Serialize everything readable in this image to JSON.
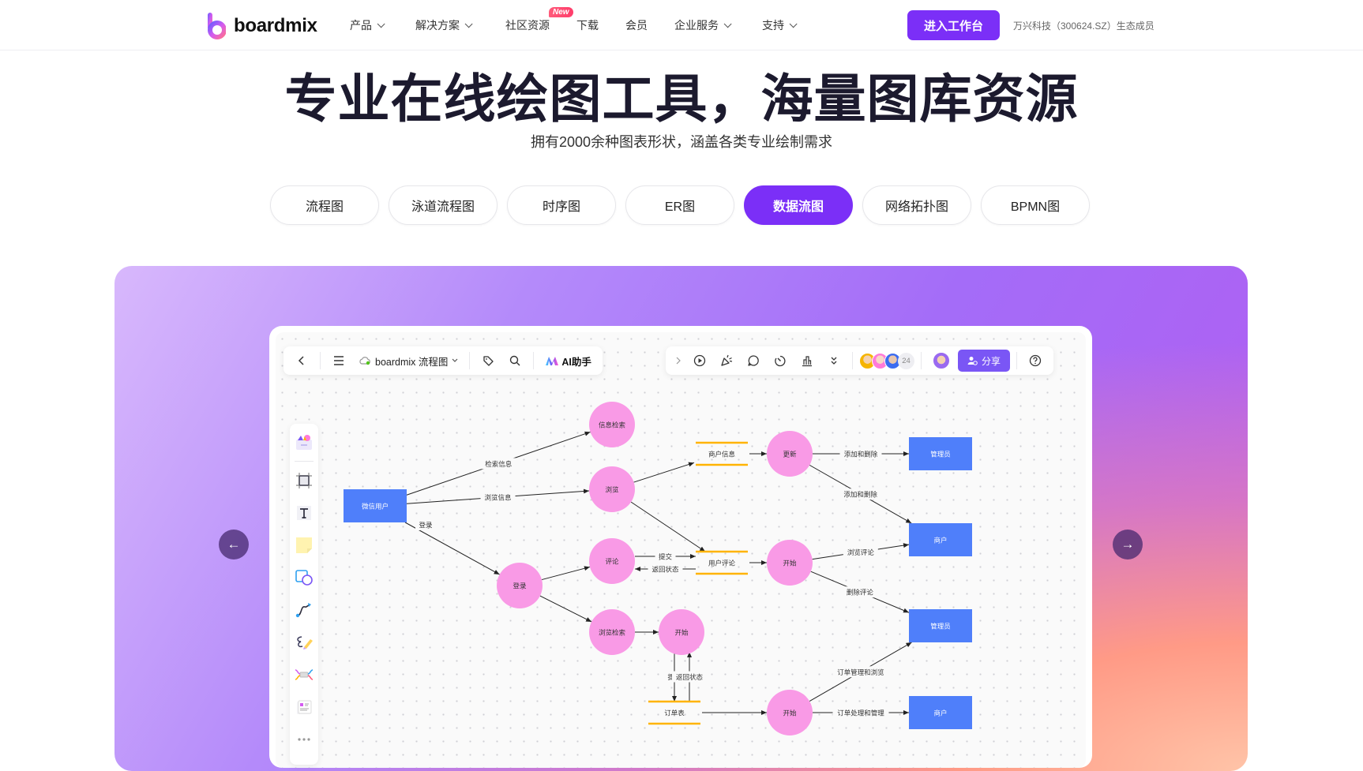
{
  "nav": {
    "logo_text": "boardmix",
    "items": [
      {
        "label": "产品",
        "has_dropdown": true
      },
      {
        "label": "解决方案",
        "has_dropdown": true
      },
      {
        "label": "社区资源",
        "has_dropdown": false,
        "badge": "New"
      },
      {
        "label": "下载",
        "has_dropdown": false
      },
      {
        "label": "会员",
        "has_dropdown": false
      },
      {
        "label": "企业服务",
        "has_dropdown": true
      },
      {
        "label": "支持",
        "has_dropdown": true
      }
    ],
    "cta_label": "进入工作台",
    "ecosystem_text": "万兴科技（300624.SZ）生态成员"
  },
  "hero": {
    "title": "专业在线绘图工具，海量图库资源",
    "subtitle": "拥有2000余种图表形状，涵盖各类专业绘制需求"
  },
  "tabs": [
    {
      "label": "流程图",
      "active": false
    },
    {
      "label": "泳道流程图",
      "active": false
    },
    {
      "label": "时序图",
      "active": false
    },
    {
      "label": "ER图",
      "active": false
    },
    {
      "label": "数据流图",
      "active": true
    },
    {
      "label": "网络拓扑图",
      "active": false
    },
    {
      "label": "BPMN图",
      "active": false
    }
  ],
  "colors": {
    "accent": "#7b2ff7",
    "share_button": "#7a56f5",
    "process_fill": "#f99ae6",
    "entity_fill": "#4f7ffa",
    "datastore_line": "#ffb400"
  },
  "app": {
    "left_toolbar": {
      "back_icon": "chevron-left-icon",
      "menu_icon": "menu-icon",
      "file_name": "boardmix 流程图",
      "tag_icon": "tag-icon",
      "search_icon": "search-icon",
      "ai_label": "AI助手"
    },
    "right_toolbar": {
      "icons": [
        "chevron-right-icon",
        "play-icon",
        "celebrate-icon",
        "comment-icon",
        "timer-icon",
        "chart-icon",
        "double-chevron-down-icon"
      ],
      "collaborator_count": "24",
      "share_label": "分享",
      "help_icon": "help-icon"
    },
    "sidebar_tools": [
      "templates-icon",
      "frame-icon",
      "text-icon",
      "sticky-note-icon",
      "shape-icon",
      "connector-icon",
      "pen-icon",
      "mindmap-icon",
      "table-card-icon",
      "more-icon"
    ]
  },
  "diagram": {
    "entities": [
      {
        "id": "wx",
        "label": "微信用户"
      },
      {
        "id": "admin1",
        "label": "管理员"
      },
      {
        "id": "merchant1",
        "label": "商户"
      },
      {
        "id": "admin2",
        "label": "管理员"
      },
      {
        "id": "merchant2",
        "label": "商户"
      }
    ],
    "processes": [
      {
        "id": "search",
        "label": "信息检索"
      },
      {
        "id": "browse",
        "label": "浏览"
      },
      {
        "id": "comment",
        "label": "评论"
      },
      {
        "id": "login",
        "label": "登录"
      },
      {
        "id": "browsesearch",
        "label": "浏览检索"
      },
      {
        "id": "start1",
        "label": "开始"
      },
      {
        "id": "update",
        "label": "更新"
      },
      {
        "id": "start2",
        "label": "开始"
      },
      {
        "id": "start3",
        "label": "开始"
      }
    ],
    "datastores": [
      {
        "id": "mi",
        "label": "商户信息"
      },
      {
        "id": "uc",
        "label": "用户评论"
      },
      {
        "id": "ot",
        "label": "订单表"
      }
    ],
    "flows": [
      {
        "from": "wx",
        "to": "search",
        "label": "检索信息"
      },
      {
        "from": "wx",
        "to": "browse",
        "label": "浏览信息"
      },
      {
        "from": "wx",
        "to": "login",
        "label": "登录"
      },
      {
        "from": "login",
        "to": "comment",
        "label": ""
      },
      {
        "from": "login",
        "to": "browsesearch",
        "label": ""
      },
      {
        "from": "browse",
        "to": "mi",
        "label": ""
      },
      {
        "from": "browse",
        "to": "uc",
        "label": ""
      },
      {
        "from": "comment",
        "to": "uc",
        "label": "提交"
      },
      {
        "from": "uc",
        "to": "comment",
        "label": "返回状态"
      },
      {
        "from": "browsesearch",
        "to": "start1",
        "label": ""
      },
      {
        "from": "start1",
        "to": "ot",
        "label": "提交"
      },
      {
        "from": "ot",
        "to": "start1",
        "label": "返回状态"
      },
      {
        "from": "mi",
        "to": "update",
        "label": ""
      },
      {
        "from": "uc",
        "to": "start2",
        "label": ""
      },
      {
        "from": "ot",
        "to": "start3",
        "label": ""
      },
      {
        "from": "update",
        "to": "admin1",
        "label": "添加和删除"
      },
      {
        "from": "update",
        "to": "merchant1",
        "label": "添加和删除"
      },
      {
        "from": "start2",
        "to": "merchant1",
        "label": "浏览评论"
      },
      {
        "from": "start2",
        "to": "admin2",
        "label": "删除评论"
      },
      {
        "from": "start3",
        "to": "admin2",
        "label": "订单管理和浏览"
      },
      {
        "from": "start3",
        "to": "merchant2",
        "label": "订单处理和管理"
      }
    ]
  },
  "carousel": {
    "prev_icon": "arrow-left-icon",
    "next_icon": "arrow-right-icon"
  }
}
